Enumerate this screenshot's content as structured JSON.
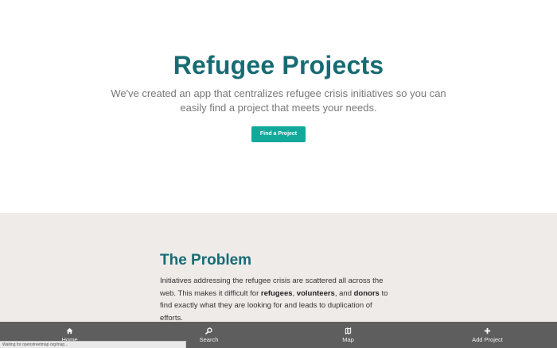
{
  "hero": {
    "title": "Refugee Projects",
    "subtitle": "We've created an app that centralizes refugee crisis initiatives so you can easily find a project that meets your needs.",
    "cta_label": "Find a Project"
  },
  "problem": {
    "title": "The Problem",
    "text_1": "Initiatives addressing the refugee crisis are scattered all across the web. This makes it difficult for ",
    "bold_1": "refugees",
    "text_2": ", ",
    "bold_2": "volunteers",
    "text_3": ", and ",
    "bold_3": "donors",
    "text_4": " to find exactly what they are looking for and leads to duplication of efforts."
  },
  "tabbar": {
    "tabs": [
      {
        "label": "Home",
        "icon": "home-icon"
      },
      {
        "label": "Search",
        "icon": "search-icon"
      },
      {
        "label": "Map",
        "icon": "map-icon"
      },
      {
        "label": "Add Project",
        "icon": "plus-icon"
      }
    ]
  },
  "status_bar": {
    "text": "Waiting for openstreetmap.org/map..."
  },
  "colors": {
    "brand_teal": "#176b73",
    "button_green": "#12a89a",
    "section_bg": "#efebe9",
    "tabbar_bg": "#5e5e5e"
  }
}
